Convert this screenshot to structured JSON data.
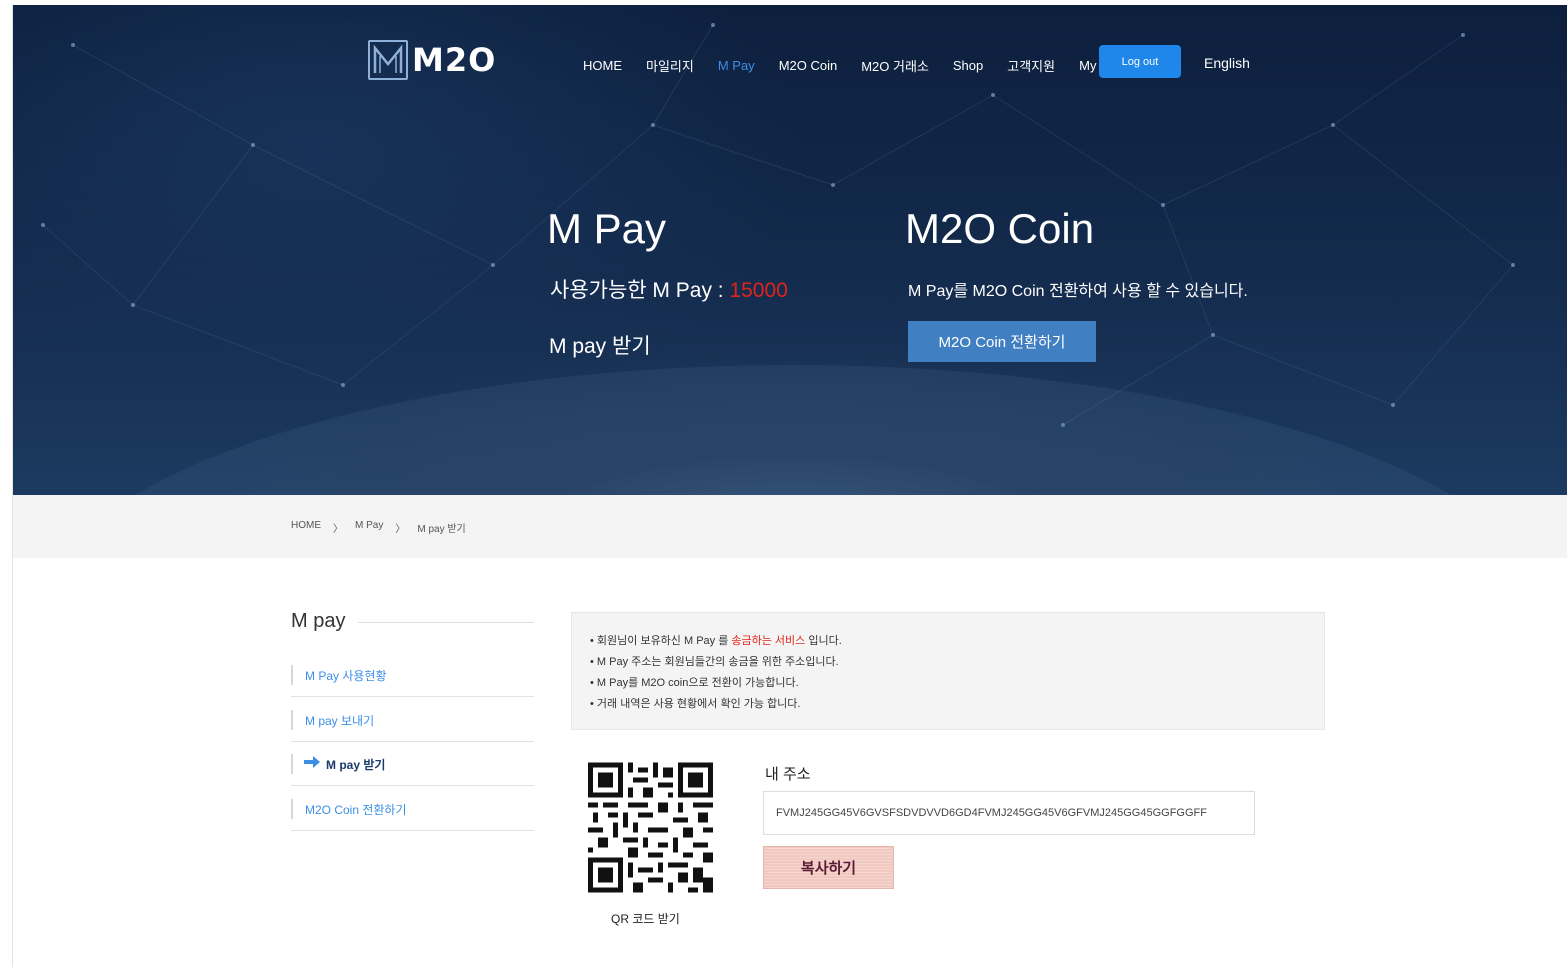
{
  "brand": {
    "logo_text": "M2O"
  },
  "nav": {
    "items": [
      {
        "label": "HOME"
      },
      {
        "label": "마일리지"
      },
      {
        "label": "M Pay",
        "active": true
      },
      {
        "label": "M2O Coin"
      },
      {
        "label": "M2O 거래소"
      },
      {
        "label": "Shop"
      },
      {
        "label": "고객지원"
      },
      {
        "label": "My Page"
      }
    ],
    "logout_label": "Log out",
    "language_label": "English"
  },
  "hero": {
    "mpay_title": "M Pay",
    "available_label": "사용가능한 M Pay : ",
    "available_value": "15000",
    "receive_label": "M pay 받기",
    "coin_title": "M2O Coin",
    "coin_desc": "M Pay를 M2O Coin 전환하여 사용 할 수 있습니다.",
    "coin_button": "M2O Coin 전환하기"
  },
  "breadcrumb": [
    "HOME",
    "〉",
    "M Pay",
    "〉",
    "M pay 받기"
  ],
  "sidebar": {
    "title": "M pay",
    "items": [
      {
        "label": "M Pay 사용현황"
      },
      {
        "label": "M pay 보내기"
      },
      {
        "label": "M pay 받기",
        "active": true
      },
      {
        "label": "M2O Coin 전환하기"
      }
    ]
  },
  "notice": {
    "line1_pre": "• 회원님이 보유하신 M Pay 를 ",
    "line1_red": "송금하는 서비스",
    "line1_post": " 입니다.",
    "line2": "• M Pay 주소는 회원님들간의 송금을 위한 주소입니다.",
    "line3": "• M Pay를 M2O coin으로 전환이 가능합니다.",
    "line4": "• 거래 내역은 사용 현황에서 확인 가능 합니다."
  },
  "receive": {
    "qr_caption": "QR 코드 받기",
    "address_label": "내 주소",
    "address_value": "FVMJ245GG45V6GVSFSDVDVVD6GD4FVMJ245GG45V6GFVMJ245GG45GGFGGFF",
    "copy_button": "복사하기"
  },
  "colors": {
    "accent": "#3d8fe6",
    "logout_bg": "#1f86ea",
    "highlight_red": "#e0241c",
    "coin_button_bg": "#3f7fc2",
    "copy_button_bg": "#f1c9c1"
  }
}
